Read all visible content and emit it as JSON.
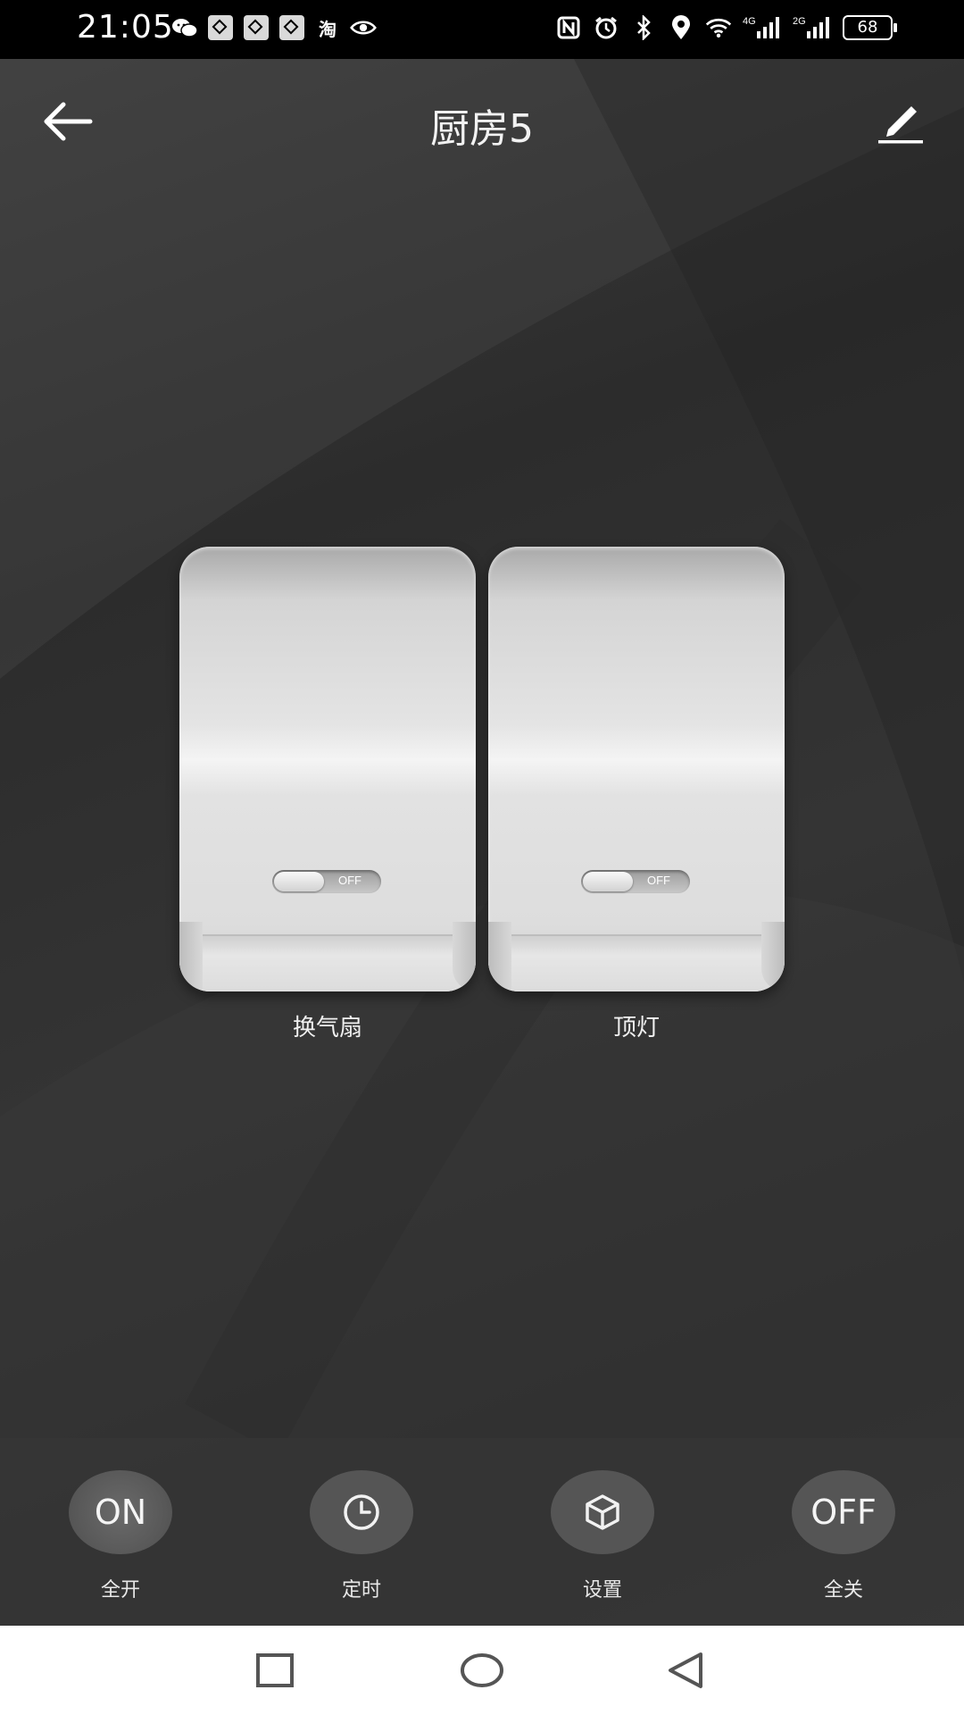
{
  "status_bar": {
    "time": "21:05",
    "left_icons": [
      "wechat-icon",
      "app-icon",
      "app-icon",
      "app-icon",
      "taobao-icon",
      "eye-icon"
    ],
    "taobao_text": "淘",
    "right_icons": [
      "nfc-icon",
      "alarm-icon",
      "bluetooth-icon",
      "location-icon",
      "wifi-icon",
      "signal-4g-icon",
      "signal-2g-icon"
    ],
    "net_4g": "4G",
    "net_2g": "2G",
    "battery": "68"
  },
  "header": {
    "title": "厨房5",
    "back_icon": "back-arrow-icon",
    "edit_icon": "pencil-icon"
  },
  "switches": [
    {
      "name": "换气扇",
      "state": "OFF"
    },
    {
      "name": "顶灯",
      "state": "OFF"
    }
  ],
  "actions": [
    {
      "icon_text": "ON",
      "label": "全开"
    },
    {
      "icon": "clock-icon",
      "label": "定时"
    },
    {
      "icon": "cube-icon",
      "label": "设置"
    },
    {
      "icon_text": "OFF",
      "label": "全关"
    }
  ],
  "nav": [
    "recent-apps-icon",
    "home-icon",
    "back-icon"
  ],
  "colors": {
    "background": "#2f2f2f",
    "status_bar": "#000000",
    "switch_face": "#e4e4e4",
    "action_circle": "#555555",
    "nav_bar": "#ffffff"
  }
}
